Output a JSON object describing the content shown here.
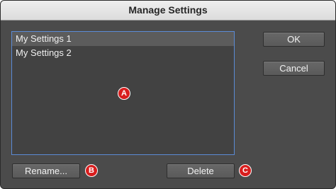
{
  "window": {
    "title": "Manage Settings"
  },
  "settings_list": {
    "items": [
      {
        "label": "My Settings 1",
        "selected": true
      },
      {
        "label": "My Settings 2",
        "selected": false
      }
    ]
  },
  "buttons": {
    "ok": "OK",
    "cancel": "Cancel",
    "rename": "Rename...",
    "delete": "Delete"
  },
  "callouts": {
    "a": "A",
    "b": "B",
    "c": "C"
  },
  "colors": {
    "dialog_background": "#4b4b4b",
    "list_border": "#5b8bd6",
    "callout": "#d81e1e"
  }
}
